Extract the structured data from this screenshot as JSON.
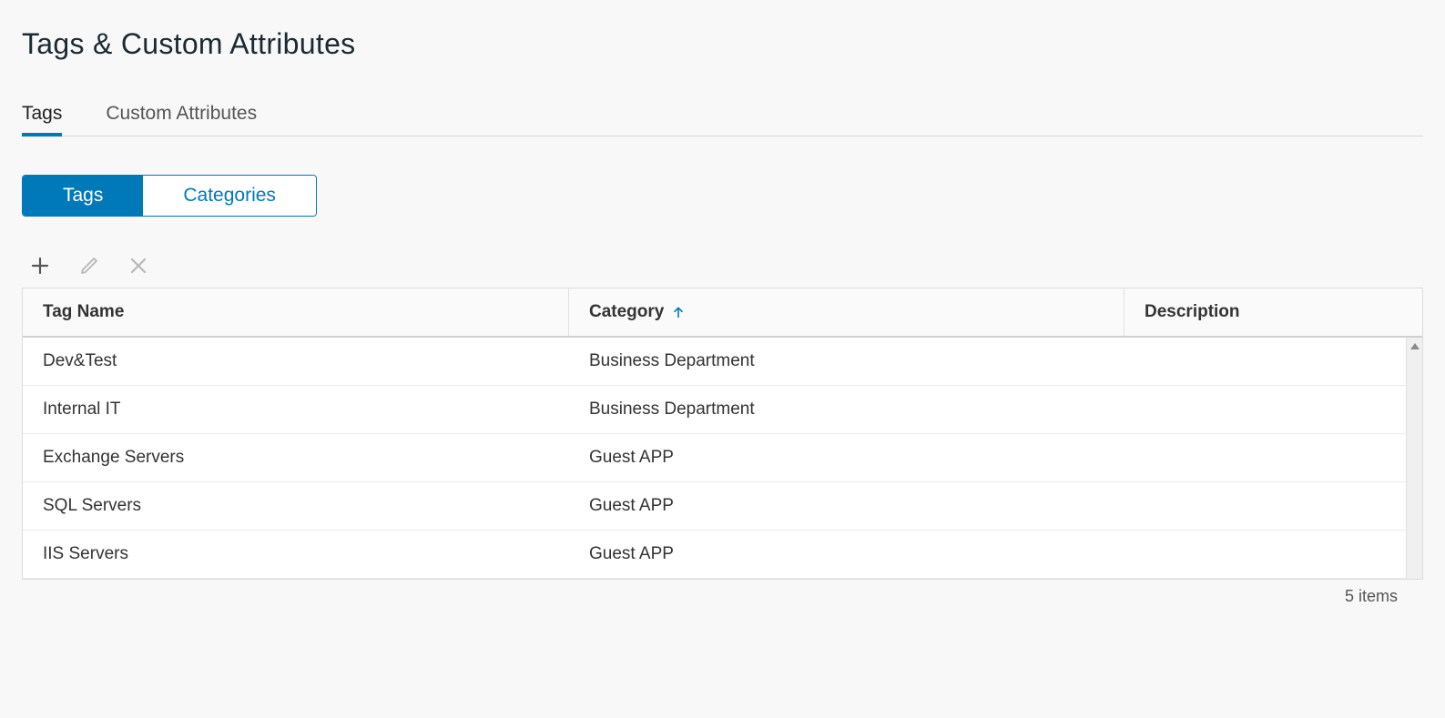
{
  "header": {
    "title": "Tags & Custom Attributes"
  },
  "main_tabs": {
    "items": [
      {
        "label": "Tags",
        "active": true
      },
      {
        "label": "Custom Attributes",
        "active": false
      }
    ]
  },
  "segmented": {
    "items": [
      {
        "label": "Tags",
        "active": true
      },
      {
        "label": "Categories",
        "active": false
      }
    ]
  },
  "toolbar": {
    "add_icon": "plus-icon",
    "edit_icon": "pencil-icon",
    "delete_icon": "x-icon"
  },
  "table": {
    "columns": [
      {
        "key": "tag_name",
        "label": "Tag Name",
        "sort": null
      },
      {
        "key": "category",
        "label": "Category",
        "sort": "asc"
      },
      {
        "key": "description",
        "label": "Description",
        "sort": null
      }
    ],
    "rows": [
      {
        "tag_name": "Dev&Test",
        "category": "Business Department",
        "description": ""
      },
      {
        "tag_name": "Internal IT",
        "category": "Business Department",
        "description": ""
      },
      {
        "tag_name": "Exchange Servers",
        "category": "Guest APP",
        "description": ""
      },
      {
        "tag_name": "SQL Servers",
        "category": "Guest APP",
        "description": ""
      },
      {
        "tag_name": "IIS Servers",
        "category": "Guest APP",
        "description": ""
      }
    ],
    "footer_count": "5 items"
  }
}
